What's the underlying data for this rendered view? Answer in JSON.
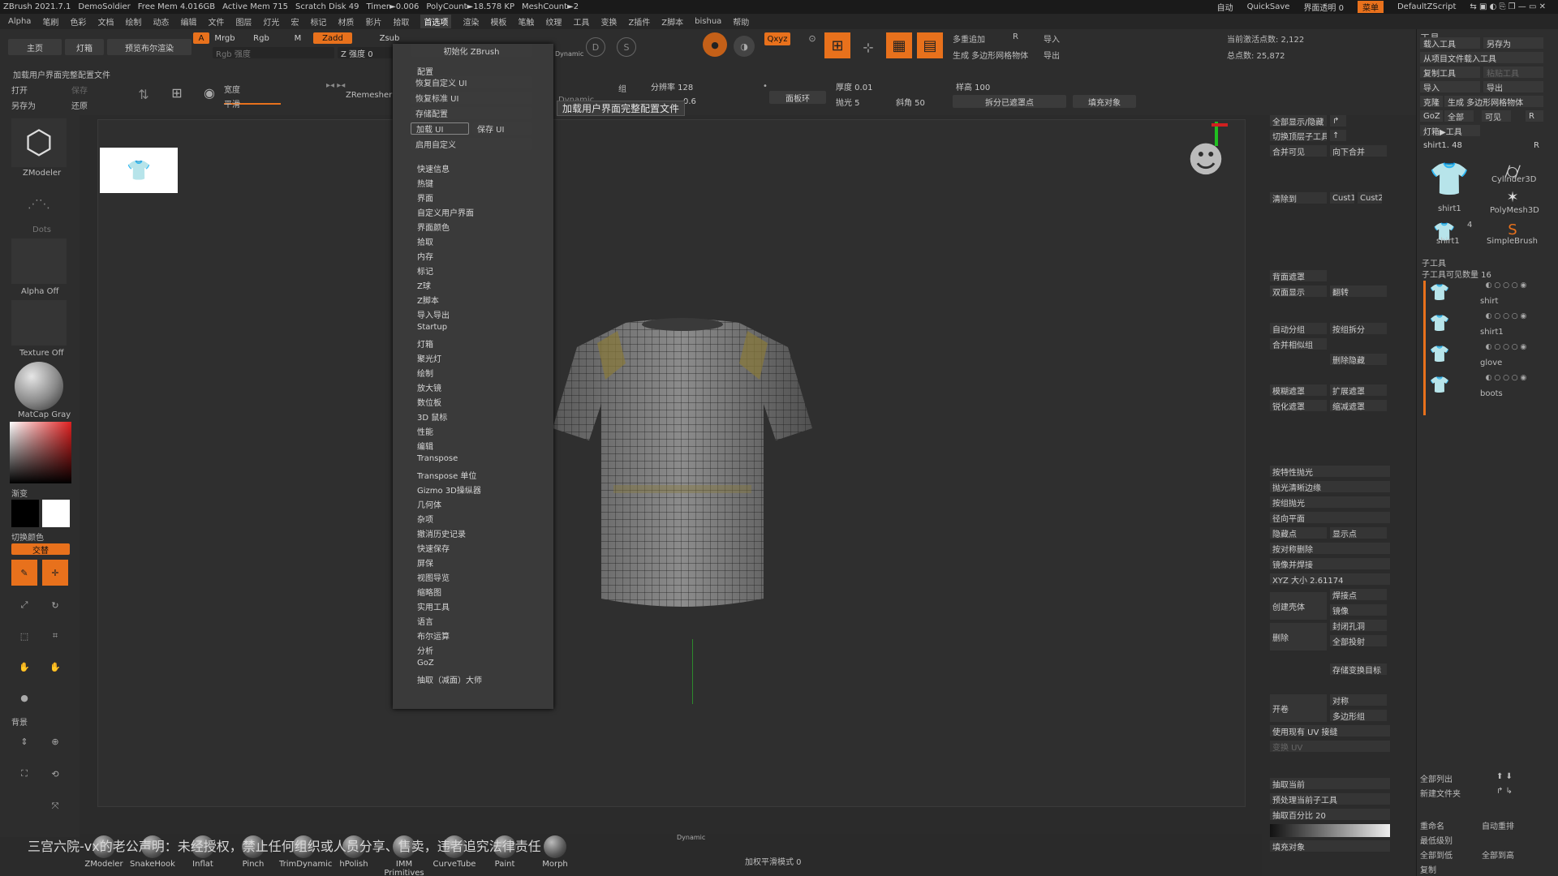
{
  "titlebar": {
    "app": "ZBrush 2021.7.1",
    "doc": "DemoSoldier",
    "free_mem": "Free Mem 4.016GB",
    "active_mem": "Active Mem 715",
    "scratch": "Scratch Disk 49",
    "timer": "Timer►0.006",
    "polycount": "PolyCount►18.578 KP",
    "meshcount": "MeshCount►2",
    "autosave": "自动",
    "quicksave": "QuickSave",
    "transparency": "界面透明 0",
    "menu_btn": "菜单",
    "script": "DefaultZScript"
  },
  "menubar": [
    "Alpha",
    "笔刷",
    "色彩",
    "文档",
    "绘制",
    "动态",
    "编辑",
    "文件",
    "图层",
    "灯光",
    "宏",
    "标记",
    "材质",
    "影片",
    "拾取",
    "首选项",
    "渲染",
    "模板",
    "笔触",
    "纹理",
    "工具",
    "变换",
    "Z插件",
    "Z脚本",
    "bishua",
    "帮助"
  ],
  "menubar_active": "首选项",
  "topshelf": {
    "home": "主页",
    "lightbox": "灯箱",
    "preview_render": "预览布尔渲染",
    "a_btn": "A",
    "mrgb": "Mrgb",
    "rgb": "Rgb",
    "m": "M",
    "zadd": "Zadd",
    "zsub": "Zsub",
    "rgb_intensity": "Rgb 强度",
    "z_intensity": "Z 强度 0",
    "load_ui_file": "加载用户界面完整配置文件",
    "open": "打开",
    "save": "保存",
    "save_as": "另存为",
    "restore": "还原",
    "gizmo_label": "动态",
    "width_label": "宽度",
    "smooth_label": "平滑",
    "zremesher": "ZRemesher",
    "dynamic": "Dynamic",
    "resolution": "分辨率 128",
    "group_label": "组",
    "thickness": "厚度 0.01",
    "polish": "抛光 5",
    "bevel": "斜角 50",
    "panel_loop": "面板环",
    "dynamic_label": "Dynamic",
    "ratio": "0.6",
    "multi_append": "多重追加",
    "r_btn": "R",
    "import": "导入",
    "gen_poly_mesh": "生成 多边形网格物体",
    "export": "导出",
    "height": "样高 100",
    "split_hidden": "拆分已遮罩点",
    "fill_object": "填充对象",
    "active_points": "当前激活点数: 2,122",
    "total_points": "总点数: 25,872",
    "qxyz": "Qxyz"
  },
  "dropdown": {
    "init": "初始化 ZBrush",
    "config": "配置",
    "restore_custom": "恢复自定义 UI",
    "restore_std": "恢复标准 UI",
    "store_config": "存储配置",
    "load_ui": "加载 UI",
    "save_ui": "保存 UI",
    "enable_custom": "启用自定义",
    "items": [
      "快速信息",
      "热键",
      "界面",
      "自定义用户界面",
      "界面颜色",
      "拾取",
      "内存",
      "标记",
      "Z球",
      "Z脚本",
      "导入导出",
      "Startup",
      "灯箱",
      "聚光灯",
      "绘制",
      "放大镜",
      "数位板",
      "3D 鼠标",
      "性能",
      "编辑",
      "Transpose",
      "Transpose 单位",
      "Gizmo 3D操纵器",
      "几何体",
      "杂项",
      "撤消历史记录",
      "快速保存",
      "屏保",
      "视图导览",
      "缩略图",
      "实用工具",
      "语言",
      "布尔运算",
      "分析",
      "GoZ",
      "抽取（减面）大师"
    ]
  },
  "tooltip": "加载用户界面完整配置文件",
  "leftshelf": {
    "zmodeler": "ZModeler",
    "dots": "Dots",
    "alpha_off": "Alpha Off",
    "texture_off": "Texture Off",
    "matcap": "MatCap Gray",
    "gradient": "渐变",
    "switch_color": "切换颜色",
    "alternate": "交替",
    "background": "背景"
  },
  "righttools": {
    "show_all": "全部显示/隐藏",
    "toggle_subtool": "切换顶层子工具",
    "merge_visible": "合并可见",
    "merge_down": "向下合并",
    "clear": "清除到",
    "cust1": "Cust1",
    "cust2": "Cust2",
    "backface_mask": "背面遮罩",
    "double": "双面显示",
    "flip": "翻转",
    "auto_groups": "自动分组",
    "split_groups": "按组拆分",
    "merge_similar": "合并相似组",
    "delete_hidden": "删除隐藏",
    "blur_mask": "模糊遮罩",
    "grow_mask": "扩展遮罩",
    "sharpen_mask": "锐化遮罩",
    "shrink_mask": "缩减遮罩",
    "polish_feature": "按特性抛光",
    "polish_crisp": "抛光清晰边缘",
    "polish_groups": "按组抛光",
    "radial_plane": "径向平面",
    "hide_points": "隐藏点",
    "show_points": "显示点",
    "symmetry_delete": "按对称删除",
    "mirror_weld": "镜像并焊接",
    "xyz_size": "XYZ 大小 2.61174",
    "create_shell": "创建壳体",
    "weld_points": "焊接点",
    "mirror": "镜像",
    "delete": "删除",
    "close_holes": "封闭孔洞",
    "project_all": "全部投射",
    "store_morph": "存储变换目标",
    "open_slot": "开卷",
    "symmetry": "对称",
    "poly_group": "多边形组",
    "use_uv": "使用现有 UV 接缝",
    "uv_change": "变换 UV",
    "extract_current": "抽取当前",
    "preprocess_current": "预处理当前子工具",
    "decimation": "抽取百分比 20",
    "fill_object2": "填充对象"
  },
  "toolpanel": {
    "header": "工具",
    "load_tool": "载入工具",
    "save_as": "另存为",
    "load_from_project": "从项目文件载入工具",
    "copy_tool": "复制工具",
    "paste_tool": "粘贴工具",
    "import": "导入",
    "export": "导出",
    "clone": "克隆",
    "gen_poly": "生成 多边形网格物体",
    "goz": "GoZ",
    "all": "全部",
    "visible": "可见",
    "r": "R",
    "lightbox_tools": "灯箱▶工具",
    "current_tool": "shirt1. 48",
    "r2": "R",
    "thumbs": [
      {
        "name": "shirt1"
      },
      {
        "name": "Cylinder3D"
      },
      {
        "name": "PolyMesh3D"
      },
      {
        "name": "shirt1"
      },
      {
        "name": "SimpleBrush"
      }
    ],
    "thumb_badge": "4",
    "subtool_header": "子工具",
    "subtool_count": "子工具可见数量 16",
    "subtools": [
      "shirt",
      "shirt1",
      "glove",
      "boots"
    ],
    "list_all": "全部列出",
    "new_folder": "新建文件夹",
    "rename": "重命名",
    "auto_reorder": "自动重排",
    "last_levels": "最低级别",
    "all_low": "全部到低",
    "all_high": "全部到高",
    "copy": "复制"
  },
  "bottomshelf": {
    "brushes": [
      "ZModeler",
      "SnakeHook",
      "Inflat",
      "Pinch",
      "TrimDynamic",
      "hPolish",
      "IMM Primitives",
      "CurveTube",
      "Paint",
      "Morph"
    ],
    "dynamic_label": "Dynamic",
    "smooth_mode": "加权平滑模式 0"
  },
  "watermark": "三宫六院-vx的老公声明：未经授权，禁止任何组织或人员分享、售卖，违者追究法律责任",
  "colors": {
    "accent": "#e8711c",
    "panel": "#2d2d2d",
    "canvas": "#2f2f2f"
  }
}
